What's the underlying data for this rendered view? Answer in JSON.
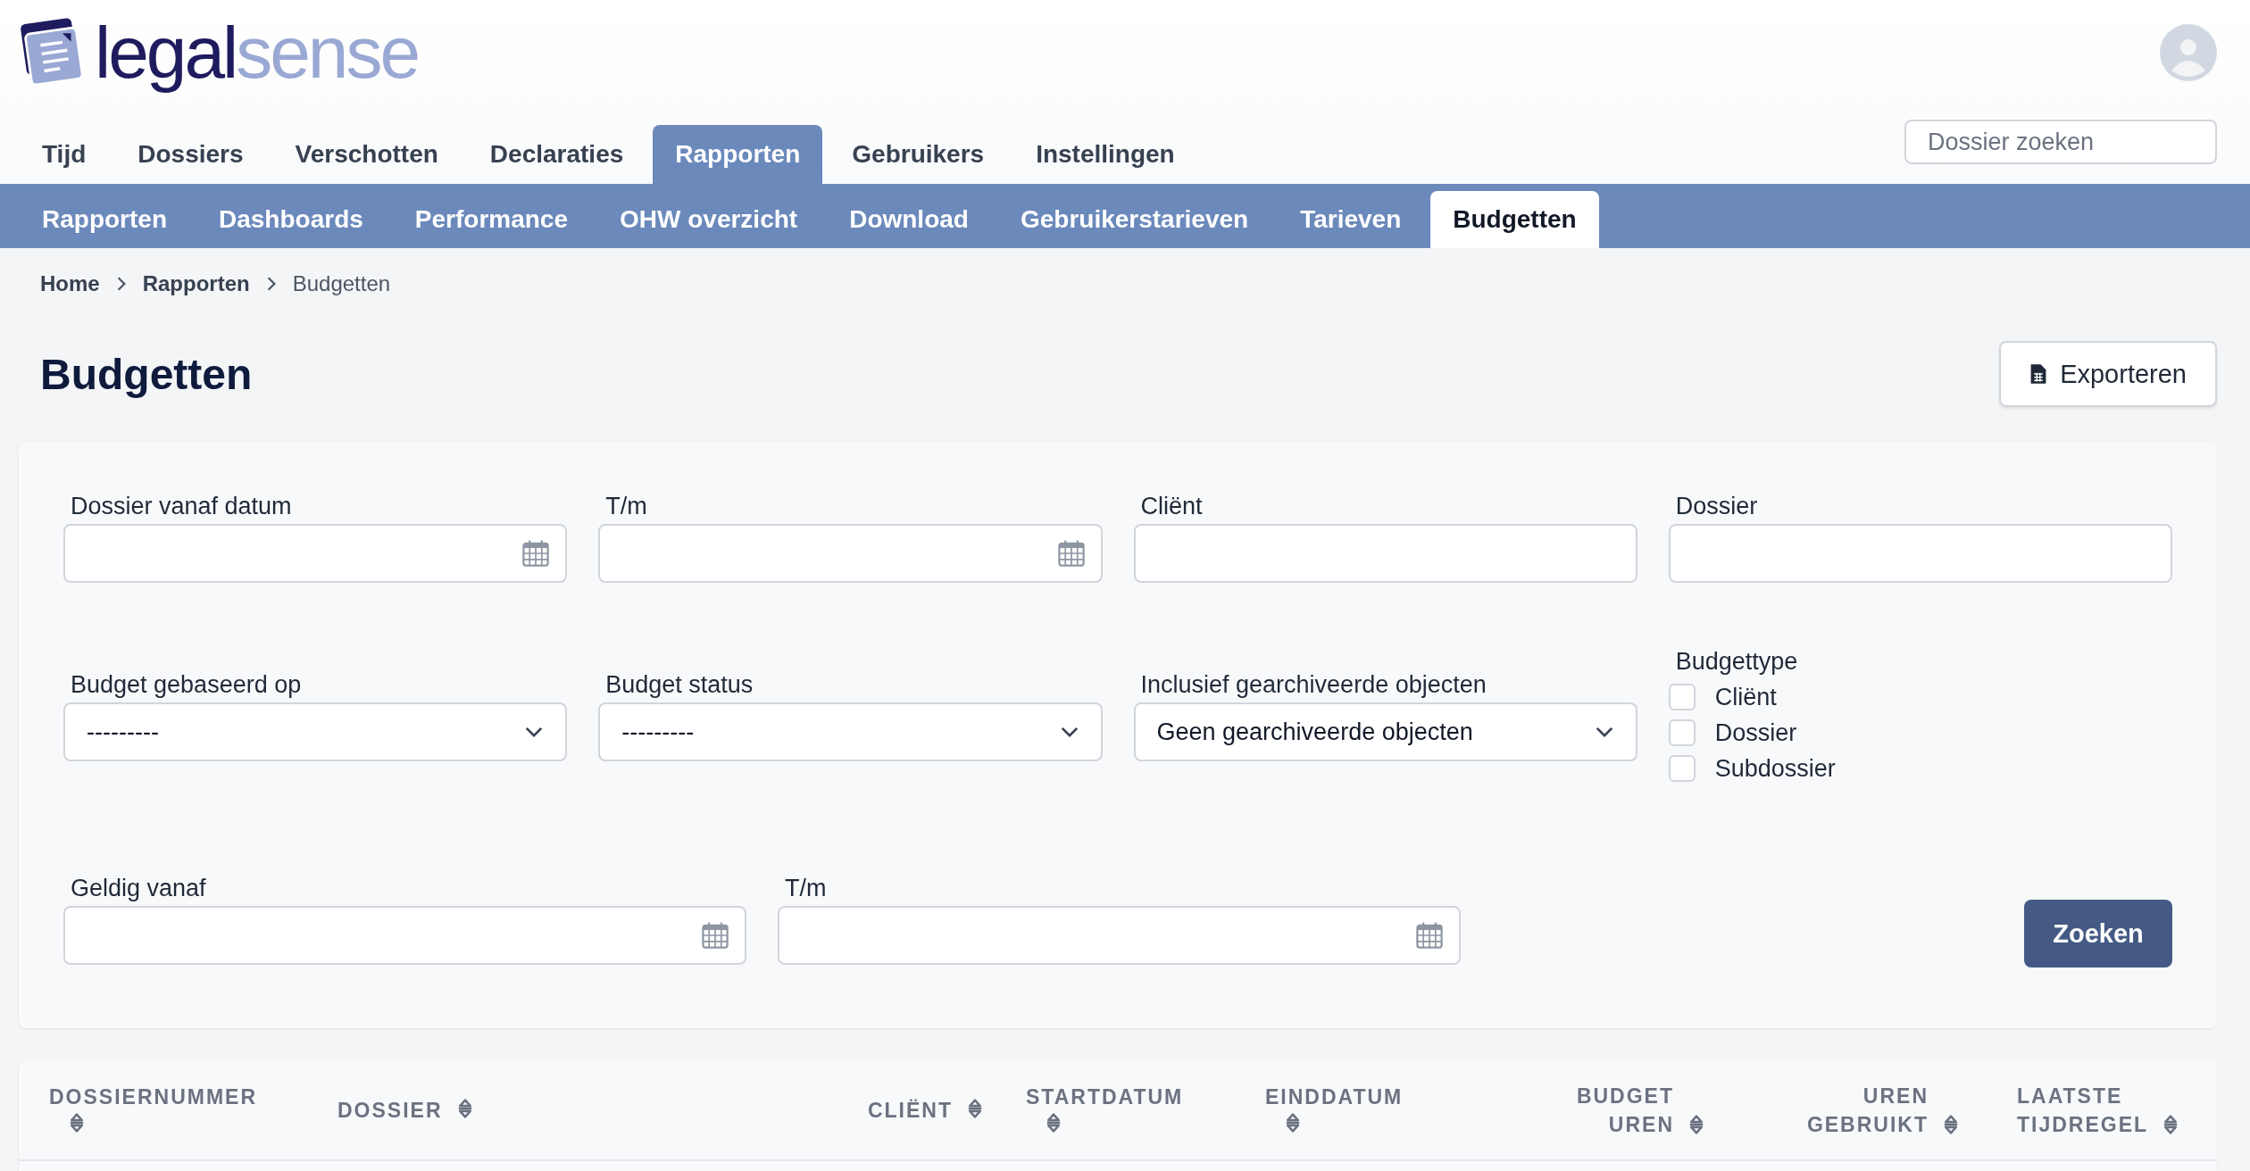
{
  "logo": {
    "part_1": "legal",
    "part_2": "sense"
  },
  "main_nav": [
    {
      "label": "Tijd",
      "selected": false
    },
    {
      "label": "Dossiers",
      "selected": false
    },
    {
      "label": "Verschotten",
      "selected": false
    },
    {
      "label": "Declaraties",
      "selected": false
    },
    {
      "label": "Rapporten",
      "selected": true
    },
    {
      "label": "Gebruikers",
      "selected": false
    },
    {
      "label": "Instellingen",
      "selected": false
    }
  ],
  "search": {
    "placeholder": "Dossier zoeken"
  },
  "sub_nav": [
    {
      "label": "Rapporten",
      "selected": false
    },
    {
      "label": "Dashboards",
      "selected": false
    },
    {
      "label": "Performance",
      "selected": false
    },
    {
      "label": "OHW overzicht",
      "selected": false
    },
    {
      "label": "Download",
      "selected": false
    },
    {
      "label": "Gebruikerstarieven",
      "selected": false
    },
    {
      "label": "Tarieven",
      "selected": false
    },
    {
      "label": "Budgetten",
      "selected": true
    }
  ],
  "breadcrumb": [
    "Home",
    "Rapporten",
    "Budgetten"
  ],
  "page_title": "Budgetten",
  "export_button": "Exporteren",
  "filters": {
    "rows": [
      [
        {
          "kind": "date",
          "label": "Dossier vanaf datum"
        },
        {
          "kind": "date",
          "label": "T/m"
        },
        {
          "kind": "text",
          "label": "Cliënt"
        },
        {
          "kind": "text",
          "label": "Dossier"
        }
      ],
      [
        {
          "kind": "select",
          "label": "Budget gebaseerd op",
          "value": "---------"
        },
        {
          "kind": "select",
          "label": "Budget status",
          "value": "---------"
        },
        {
          "kind": "select",
          "label": "Inclusief gearchiveerde objecten",
          "value": "Geen gearchiveerde objecten"
        },
        {
          "kind": "checkboxes",
          "label": "Budgettype",
          "options": [
            {
              "label": "Cliënt",
              "checked": false
            },
            {
              "label": "Dossier",
              "checked": false
            },
            {
              "label": "Subdossier",
              "checked": false
            }
          ]
        }
      ],
      [
        {
          "kind": "date",
          "label": "Geldig vanaf"
        },
        {
          "kind": "date",
          "label": "T/m"
        }
      ]
    ],
    "search_button": "Zoeken"
  },
  "table": {
    "columns": [
      "DOSSIERNUMMER",
      "DOSSIER",
      "CLIËNT",
      "STARTDATUM",
      "EINDDATUM",
      "BUDGET UREN",
      "UREN GEBRUIKT",
      "LAATSTE TIJDREGEL"
    ]
  }
}
